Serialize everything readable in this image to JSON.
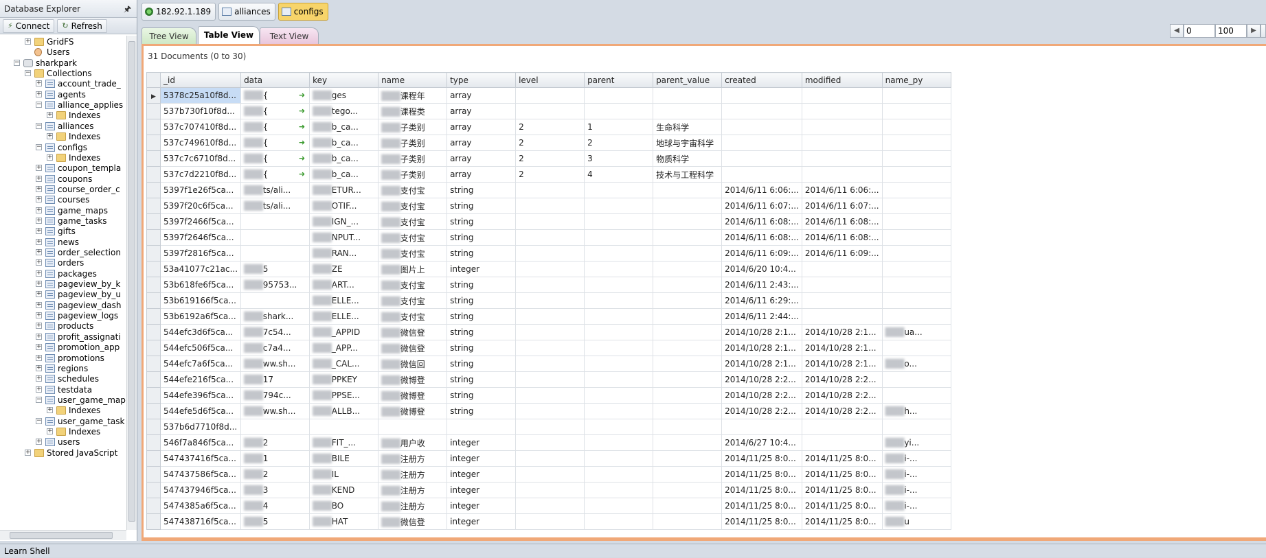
{
  "explorer": {
    "title": "Database Explorer",
    "connect_label": "Connect",
    "refresh_label": "Refresh",
    "tree": [
      {
        "label": "GridFS",
        "indent": 1,
        "icon": "folder",
        "box": "+"
      },
      {
        "label": "Users",
        "indent": 1,
        "icon": "user",
        "box": ""
      },
      {
        "label": "sharkpark",
        "indent": 0,
        "icon": "database",
        "box": "-"
      },
      {
        "label": "Collections",
        "indent": 1,
        "icon": "folder",
        "box": "-"
      },
      {
        "label": "account_trade_",
        "indent": 2,
        "icon": "collection",
        "box": "+"
      },
      {
        "label": "agents",
        "indent": 2,
        "icon": "collection",
        "box": "+"
      },
      {
        "label": "alliance_applies",
        "indent": 2,
        "icon": "collection",
        "box": "-"
      },
      {
        "label": "Indexes",
        "indent": 3,
        "icon": "folder",
        "box": "+"
      },
      {
        "label": "alliances",
        "indent": 2,
        "icon": "collection",
        "box": "-"
      },
      {
        "label": "Indexes",
        "indent": 3,
        "icon": "folder",
        "box": "+"
      },
      {
        "label": "configs",
        "indent": 2,
        "icon": "collection",
        "box": "-"
      },
      {
        "label": "Indexes",
        "indent": 3,
        "icon": "folder",
        "box": "+"
      },
      {
        "label": "coupon_templa",
        "indent": 2,
        "icon": "collection",
        "box": "+"
      },
      {
        "label": "coupons",
        "indent": 2,
        "icon": "collection",
        "box": "+"
      },
      {
        "label": "course_order_c",
        "indent": 2,
        "icon": "collection",
        "box": "+"
      },
      {
        "label": "courses",
        "indent": 2,
        "icon": "collection",
        "box": "+"
      },
      {
        "label": "game_maps",
        "indent": 2,
        "icon": "collection",
        "box": "+"
      },
      {
        "label": "game_tasks",
        "indent": 2,
        "icon": "collection",
        "box": "+"
      },
      {
        "label": "gifts",
        "indent": 2,
        "icon": "collection",
        "box": "+"
      },
      {
        "label": "news",
        "indent": 2,
        "icon": "collection",
        "box": "+"
      },
      {
        "label": "order_selection",
        "indent": 2,
        "icon": "collection",
        "box": "+"
      },
      {
        "label": "orders",
        "indent": 2,
        "icon": "collection",
        "box": "+"
      },
      {
        "label": "packages",
        "indent": 2,
        "icon": "collection",
        "box": "+"
      },
      {
        "label": "pageview_by_k",
        "indent": 2,
        "icon": "collection",
        "box": "+"
      },
      {
        "label": "pageview_by_u",
        "indent": 2,
        "icon": "collection",
        "box": "+"
      },
      {
        "label": "pageview_dash",
        "indent": 2,
        "icon": "collection",
        "box": "+"
      },
      {
        "label": "pageview_logs",
        "indent": 2,
        "icon": "collection",
        "box": "+"
      },
      {
        "label": "products",
        "indent": 2,
        "icon": "collection",
        "box": "+"
      },
      {
        "label": "profit_assignati",
        "indent": 2,
        "icon": "collection",
        "box": "+"
      },
      {
        "label": "promotion_app",
        "indent": 2,
        "icon": "collection",
        "box": "+"
      },
      {
        "label": "promotions",
        "indent": 2,
        "icon": "collection",
        "box": "+"
      },
      {
        "label": "regions",
        "indent": 2,
        "icon": "collection",
        "box": "+"
      },
      {
        "label": "schedules",
        "indent": 2,
        "icon": "collection",
        "box": "+"
      },
      {
        "label": "testdata",
        "indent": 2,
        "icon": "collection",
        "box": "+"
      },
      {
        "label": "user_game_map",
        "indent": 2,
        "icon": "collection",
        "box": "-"
      },
      {
        "label": "Indexes",
        "indent": 3,
        "icon": "folder",
        "box": "+"
      },
      {
        "label": "user_game_task",
        "indent": 2,
        "icon": "collection",
        "box": "-"
      },
      {
        "label": "Indexes",
        "indent": 3,
        "icon": "folder",
        "box": "+"
      },
      {
        "label": "users",
        "indent": 2,
        "icon": "collection",
        "box": "+"
      },
      {
        "label": "Stored JavaScript",
        "indent": 1,
        "icon": "folder",
        "box": "+"
      }
    ]
  },
  "connection_tabs": [
    {
      "label": "182.92.1.189",
      "icon": "server-icon",
      "active": false
    },
    {
      "label": "alliances",
      "icon": "table-icon",
      "active": false
    },
    {
      "label": "configs",
      "icon": "table-icon",
      "active": true
    }
  ],
  "view_tabs": {
    "tree": "Tree View",
    "table": "Table View",
    "text": "Text View"
  },
  "pager": {
    "start": "0",
    "limit": "100"
  },
  "doc_count": "31 Documents (0 to 30)",
  "table": {
    "columns": [
      "_id",
      "data",
      "key",
      "name",
      "type",
      "level",
      "parent",
      "parent_value",
      "created",
      "modified",
      "name_py"
    ],
    "rows": [
      {
        "_id": "5378c25a10f8d...",
        "data": "{",
        "key": "ges",
        "name": "课程年",
        "type": "array",
        "level": "",
        "parent": "",
        "parent_value": "",
        "created": "",
        "modified": "",
        "name_py": "",
        "arrow": true
      },
      {
        "_id": "537b730f10f8d...",
        "data": "{",
        "key": "tego...",
        "name": "课程类",
        "type": "array",
        "level": "",
        "parent": "",
        "parent_value": "",
        "created": "",
        "modified": "",
        "name_py": "",
        "arrow": true
      },
      {
        "_id": "537c707410f8d...",
        "data": "{",
        "key": "b_ca...",
        "name": "子类别",
        "type": "array",
        "level": "2",
        "parent": "1",
        "parent_value": "生命科学",
        "created": "",
        "modified": "",
        "name_py": "",
        "arrow": true
      },
      {
        "_id": "537c749610f8d...",
        "data": "{",
        "key": "b_ca...",
        "name": "子类别",
        "type": "array",
        "level": "2",
        "parent": "2",
        "parent_value": "地球与宇宙科学",
        "created": "",
        "modified": "",
        "name_py": "",
        "arrow": true
      },
      {
        "_id": "537c7c6710f8d...",
        "data": "{",
        "key": "b_ca...",
        "name": "子类别",
        "type": "array",
        "level": "2",
        "parent": "3",
        "parent_value": "物质科学",
        "created": "",
        "modified": "",
        "name_py": "",
        "arrow": true
      },
      {
        "_id": "537c7d2210f8d...",
        "data": "{",
        "key": "b_ca...",
        "name": "子类别",
        "type": "array",
        "level": "2",
        "parent": "4",
        "parent_value": "技术与工程科学",
        "created": "",
        "modified": "",
        "name_py": "",
        "arrow": true
      },
      {
        "_id": "5397f1e26f5ca...",
        "data": "ts/ali...",
        "key": "ETUR...",
        "name": "支付宝",
        "type": "string",
        "level": "",
        "parent": "",
        "parent_value": "",
        "created": "2014/6/11 6:06:...",
        "modified": "2014/6/11 6:06:...",
        "name_py": ""
      },
      {
        "_id": "5397f20c6f5ca...",
        "data": "ts/ali...",
        "key": "OTIF...",
        "name": "支付宝",
        "type": "string",
        "level": "",
        "parent": "",
        "parent_value": "",
        "created": "2014/6/11 6:07:...",
        "modified": "2014/6/11 6:07:...",
        "name_py": ""
      },
      {
        "_id": "5397f2466f5ca...",
        "data": "",
        "key": "IGN_...",
        "name": "支付宝",
        "type": "string",
        "level": "",
        "parent": "",
        "parent_value": "",
        "created": "2014/6/11 6:08:...",
        "modified": "2014/6/11 6:08:...",
        "name_py": ""
      },
      {
        "_id": "5397f2646f5ca...",
        "data": "",
        "key": "NPUT...",
        "name": "支付宝",
        "type": "string",
        "level": "",
        "parent": "",
        "parent_value": "",
        "created": "2014/6/11 6:08:...",
        "modified": "2014/6/11 6:08:...",
        "name_py": ""
      },
      {
        "_id": "5397f2816f5ca...",
        "data": "",
        "key": "RAN...",
        "name": "支付宝",
        "type": "string",
        "level": "",
        "parent": "",
        "parent_value": "",
        "created": "2014/6/11 6:09:...",
        "modified": "2014/6/11 6:09:...",
        "name_py": ""
      },
      {
        "_id": "53a41077c21ac...",
        "data": "5",
        "key": "ZE",
        "name": "图片上",
        "type": "integer",
        "level": "",
        "parent": "",
        "parent_value": "",
        "created": "2014/6/20 10:4...",
        "modified": "",
        "name_py": ""
      },
      {
        "_id": "53b618fe6f5ca...",
        "data": "95753...",
        "key": "ART...",
        "name": "支付宝",
        "type": "string",
        "level": "",
        "parent": "",
        "parent_value": "",
        "created": "2014/6/11 2:43:...",
        "modified": "",
        "name_py": ""
      },
      {
        "_id": "53b619166f5ca...",
        "data": "",
        "key": "ELLE...",
        "name": "支付宝",
        "type": "string",
        "level": "",
        "parent": "",
        "parent_value": "",
        "created": "2014/6/11 6:29:...",
        "modified": "",
        "name_py": ""
      },
      {
        "_id": "53b6192a6f5ca...",
        "data": "shark...",
        "key": "ELLE...",
        "name": "支付宝",
        "type": "string",
        "level": "",
        "parent": "",
        "parent_value": "",
        "created": "2014/6/11 2:44:...",
        "modified": "",
        "name_py": ""
      },
      {
        "_id": "544efc3d6f5ca...",
        "data": "7c54...",
        "key": "_APPID",
        "name": "微信登",
        "type": "string",
        "level": "",
        "parent": "",
        "parent_value": "",
        "created": "2014/10/28 2:1...",
        "modified": "2014/10/28 2:1...",
        "name_py": "ua..."
      },
      {
        "_id": "544efc506f5ca...",
        "data": "c7a4...",
        "key": "_APP...",
        "name": "微信登",
        "type": "string",
        "level": "",
        "parent": "",
        "parent_value": "",
        "created": "2014/10/28 2:1...",
        "modified": "2014/10/28 2:1...",
        "name_py": ""
      },
      {
        "_id": "544efc7a6f5ca...",
        "data": "ww.sh...",
        "key": "_CAL...",
        "name": "微信回",
        "type": "string",
        "level": "",
        "parent": "",
        "parent_value": "",
        "created": "2014/10/28 2:1...",
        "modified": "2014/10/28 2:1...",
        "name_py": "o..."
      },
      {
        "_id": "544efe216f5ca...",
        "data": "17",
        "key": "PPKEY",
        "name": "微博登",
        "type": "string",
        "level": "",
        "parent": "",
        "parent_value": "",
        "created": "2014/10/28 2:2...",
        "modified": "2014/10/28 2:2...",
        "name_py": ""
      },
      {
        "_id": "544efe396f5ca...",
        "data": "794c...",
        "key": "PPSE...",
        "name": "微博登",
        "type": "string",
        "level": "",
        "parent": "",
        "parent_value": "",
        "created": "2014/10/28 2:2...",
        "modified": "2014/10/28 2:2...",
        "name_py": ""
      },
      {
        "_id": "544efe5d6f5ca...",
        "data": "ww.sh...",
        "key": "ALLB...",
        "name": "微博登",
        "type": "string",
        "level": "",
        "parent": "",
        "parent_value": "",
        "created": "2014/10/28 2:2...",
        "modified": "2014/10/28 2:2...",
        "name_py": "h..."
      },
      {
        "_id": "537b6d7710f8d...",
        "data": "",
        "key": "",
        "name": "",
        "type": "",
        "level": "",
        "parent": "",
        "parent_value": "",
        "created": "",
        "modified": "",
        "name_py": ""
      },
      {
        "_id": "546f7a846f5ca...",
        "data": "2",
        "key": "FIT_...",
        "name": "用户收",
        "type": "integer",
        "level": "",
        "parent": "",
        "parent_value": "",
        "created": "2014/6/27 10:4...",
        "modified": "",
        "name_py": "yi..."
      },
      {
        "_id": "547437416f5ca...",
        "data": "1",
        "key": "BILE",
        "name": "注册方",
        "type": "integer",
        "level": "",
        "parent": "",
        "parent_value": "",
        "created": "2014/11/25 8:0...",
        "modified": "2014/11/25 8:0...",
        "name_py": "i-..."
      },
      {
        "_id": "547437586f5ca...",
        "data": "2",
        "key": "IL",
        "name": "注册方",
        "type": "integer",
        "level": "",
        "parent": "",
        "parent_value": "",
        "created": "2014/11/25 8:0...",
        "modified": "2014/11/25 8:0...",
        "name_py": "i-..."
      },
      {
        "_id": "547437946f5ca...",
        "data": "3",
        "key": "KEND",
        "name": "注册方",
        "type": "integer",
        "level": "",
        "parent": "",
        "parent_value": "",
        "created": "2014/11/25 8:0...",
        "modified": "2014/11/25 8:0...",
        "name_py": "i-..."
      },
      {
        "_id": "5474385a6f5ca...",
        "data": "4",
        "key": "BO",
        "name": "注册方",
        "type": "integer",
        "level": "",
        "parent": "",
        "parent_value": "",
        "created": "2014/11/25 8:0...",
        "modified": "2014/11/25 8:0...",
        "name_py": "i-..."
      },
      {
        "_id": "547438716f5ca...",
        "data": "5",
        "key": "HAT",
        "name": "微信登",
        "type": "integer",
        "level": "",
        "parent": "",
        "parent_value": "",
        "created": "2014/11/25 8:0...",
        "modified": "2014/11/25 8:0...",
        "name_py": "u"
      }
    ]
  },
  "statusbar": {
    "text": "Learn Shell"
  }
}
